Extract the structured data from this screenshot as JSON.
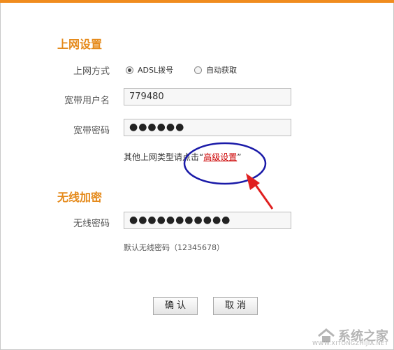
{
  "internet": {
    "title": "上网设置",
    "mode_label": "上网方式",
    "options": [
      {
        "label": "ADSL拨号",
        "checked": true
      },
      {
        "label": "自动获取",
        "checked": false
      }
    ],
    "username_label": "宽带用户名",
    "username_value": "779480",
    "password_label": "宽带密码",
    "password_mask": "●●●●●●",
    "hint_prefix": "其他上网类型请点击“",
    "hint_link": "高级设置",
    "hint_suffix": "”"
  },
  "wireless": {
    "title": "无线加密",
    "password_label": "无线密码",
    "password_mask": "●●●●●●●●●●●",
    "default_note": "默认无线密码（12345678）"
  },
  "buttons": {
    "confirm": "确认",
    "cancel": "取消"
  },
  "annotation": {
    "color": "#1a1aa8",
    "arrow_color": "#e02020"
  },
  "watermark": {
    "text": "系统之家",
    "sub": "WWW.XITONGZHIJIA.NET"
  },
  "colors": {
    "accent": "#f08c1e",
    "title": "#e58a1b",
    "link": "#cc0000"
  }
}
